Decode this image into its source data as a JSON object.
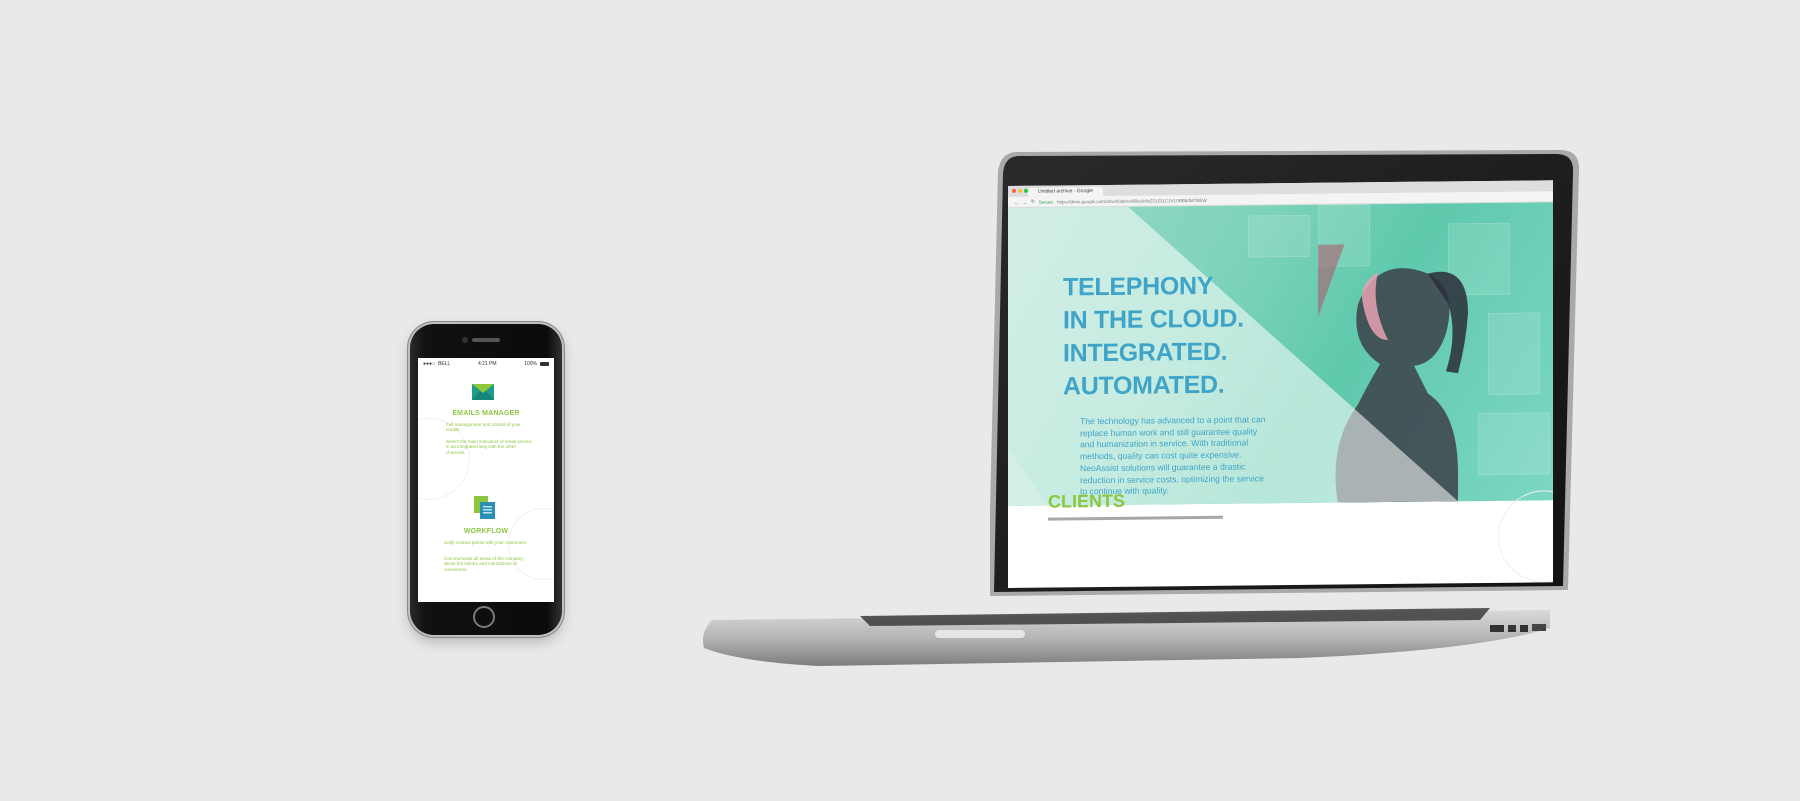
{
  "phone": {
    "status": {
      "carrier": "BELL",
      "time": "4:21 PM",
      "battery": "100%"
    },
    "section1": {
      "title": "EMAILS MANAGER",
      "text1": "Full management and control of your emails",
      "text2": "Select the main indicators of email service in an integrated way with the other channels"
    },
    "section2": {
      "title": "WORKFLOW",
      "text1": "Unify contact points with your customers",
      "text2": "Communicate all areas of the company about the history and interactions of consumers"
    },
    "icons": {
      "mail": "email-envelope-icon",
      "doc": "documents-icon"
    }
  },
  "laptop": {
    "browser": {
      "tab_title": "Untitled archive - Google",
      "secure": "Secure",
      "url": "https://drive.google.com/drive/folders/0Bw1KtbZSLEt1C3VL0RBb0MTBEW"
    },
    "hero": {
      "line1": "TELEPHONY",
      "line2": "IN THE CLOUD.",
      "line3": "INTEGRATED.",
      "line4": "AUTOMATED.",
      "paragraph": "The technology has advanced to a point that can replace human work and still guarantee quality and humanization in service. With traditional methods, quality can cost quite expensive. NeoAssist solutions will guarantee a drastic reduction in service costs, optimizing the service to continue with quality."
    },
    "clients_heading": "CLIENTS"
  },
  "colors": {
    "accent_green": "#8cc63f",
    "accent_blue": "#3fa4c8",
    "hero_teal": "#5fc9ac",
    "background": "#e9e9e9"
  }
}
